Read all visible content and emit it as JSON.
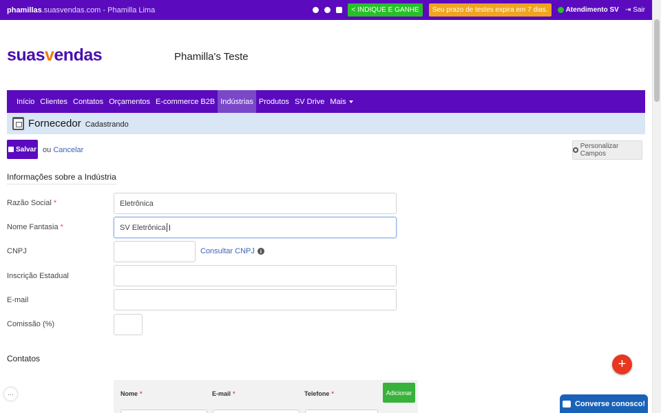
{
  "topbar": {
    "account_bold": "phamillas",
    "account_domain": ".suasvendas.com",
    "account_user": " - Phamilla Lima",
    "indique_label": "INDIQUE E GANHE",
    "trial_label": "Seu prazo de testes expira em 7 dias.",
    "support_label": "Atendimento SV",
    "logout_label": "Sair"
  },
  "brand": {
    "logo_part1": "suas",
    "logo_v": "v",
    "logo_part2": "endas",
    "company_name": "Phamilla's Teste"
  },
  "nav": {
    "items": [
      "Início",
      "Clientes",
      "Contatos",
      "Orçamentos",
      "E-commerce B2B",
      "Indústrias",
      "Produtos",
      "SV Drive",
      "Mais"
    ],
    "active": "Indústrias"
  },
  "page": {
    "title": "Fornecedor",
    "subtitle": "Cadastrando"
  },
  "actions": {
    "save_label": "Salvar",
    "or_text": "ou",
    "cancel_label": "Cancelar",
    "personalize_label": "Personalizar Campos"
  },
  "form": {
    "section_title": "Informações sobre a Indústria",
    "required_mark": "*",
    "razao_social_label": "Razão Social",
    "razao_social_value": "Eletrônica",
    "nome_fantasia_label": "Nome Fantasia",
    "nome_fantasia_value": "SV Eletrônica",
    "cnpj_label": "CNPJ",
    "cnpj_value": "",
    "cnpj_link": "Consultar CNPJ",
    "inscricao_label": "Inscrição Estadual",
    "inscricao_value": "",
    "email_label": "E-mail",
    "email_value": "",
    "comissao_label": "Comissão (%)",
    "comissao_value": ""
  },
  "contacts": {
    "section_title": "Contatos",
    "columns": [
      "Nome",
      "E-mail",
      "Telefone"
    ],
    "add_label": "Adicionar"
  },
  "widgets": {
    "fab_symbol": "+",
    "chat_label": "Converse conosco!",
    "more_symbol": "···"
  },
  "colors": {
    "primary": "#5b0bbd",
    "accent_orange": "#f27a0c",
    "green": "#27c127",
    "trial": "#f0a51e",
    "header_bg": "#d9e6f5",
    "fab": "#e8361f",
    "chat": "#1a62b8"
  }
}
